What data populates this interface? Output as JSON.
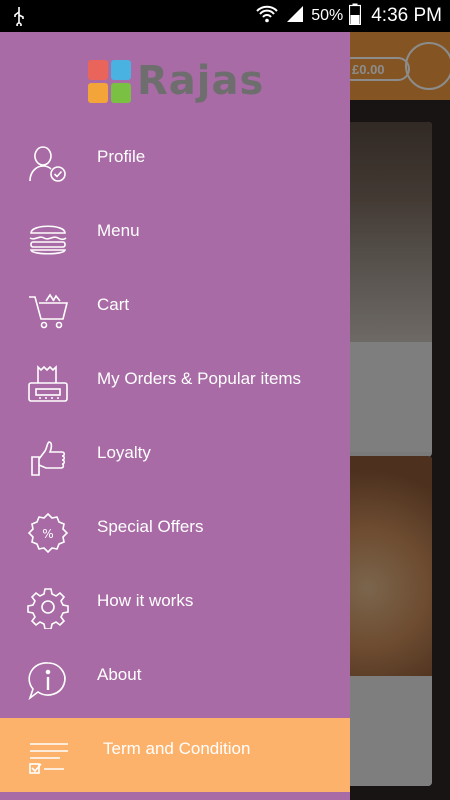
{
  "status_bar": {
    "battery_percent": "50%",
    "time": "4:36 PM"
  },
  "background": {
    "cart_total": "£0.00"
  },
  "brand": {
    "name": "Rajas",
    "tile_colors": [
      "#e9655b",
      "#4ab2e0",
      "#f4a53a",
      "#7ac143"
    ]
  },
  "menu": {
    "items": [
      {
        "label": "Profile",
        "icon": "profile-icon"
      },
      {
        "label": "Menu",
        "icon": "burger-icon"
      },
      {
        "label": "Cart",
        "icon": "cart-icon"
      },
      {
        "label": "My Orders & Popular items",
        "icon": "orders-icon"
      },
      {
        "label": "Loyalty",
        "icon": "thumbs-up-icon"
      },
      {
        "label": "Special Offers",
        "icon": "percent-badge-icon"
      },
      {
        "label": "How it works",
        "icon": "gear-icon"
      },
      {
        "label": "About",
        "icon": "info-icon"
      },
      {
        "label": "Term and Condition",
        "icon": "terms-icon",
        "selected": true
      }
    ]
  },
  "colors": {
    "drawer": "#a86ba5",
    "highlight": "#fdb26b",
    "header": "#f19a3e"
  }
}
